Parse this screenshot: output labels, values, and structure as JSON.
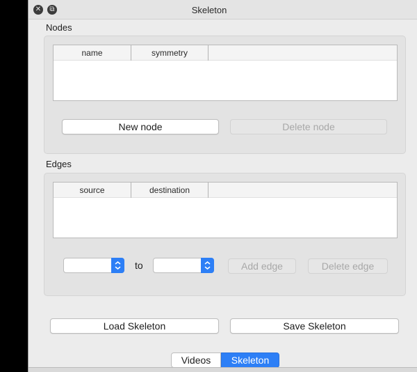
{
  "window": {
    "title": "Skeleton",
    "close_glyph": "✕",
    "float_glyph": "⧉"
  },
  "nodes": {
    "group_label": "Nodes",
    "columns": [
      "name",
      "symmetry"
    ],
    "rows": [],
    "new_node_label": "New node",
    "delete_node_label": "Delete node"
  },
  "edges": {
    "group_label": "Edges",
    "columns": [
      "source",
      "destination"
    ],
    "rows": [],
    "source_value": "",
    "to_label": "to",
    "destination_value": "",
    "add_edge_label": "Add edge",
    "delete_edge_label": "Delete edge"
  },
  "actions": {
    "load_label": "Load Skeleton",
    "save_label": "Save Skeleton"
  },
  "tabs": [
    {
      "label": "Videos",
      "active": false
    },
    {
      "label": "Skeleton",
      "active": true
    }
  ],
  "colors": {
    "accent": "#2d7ff6",
    "panel": "#ececec",
    "groupbox": "#e3e3e3"
  }
}
